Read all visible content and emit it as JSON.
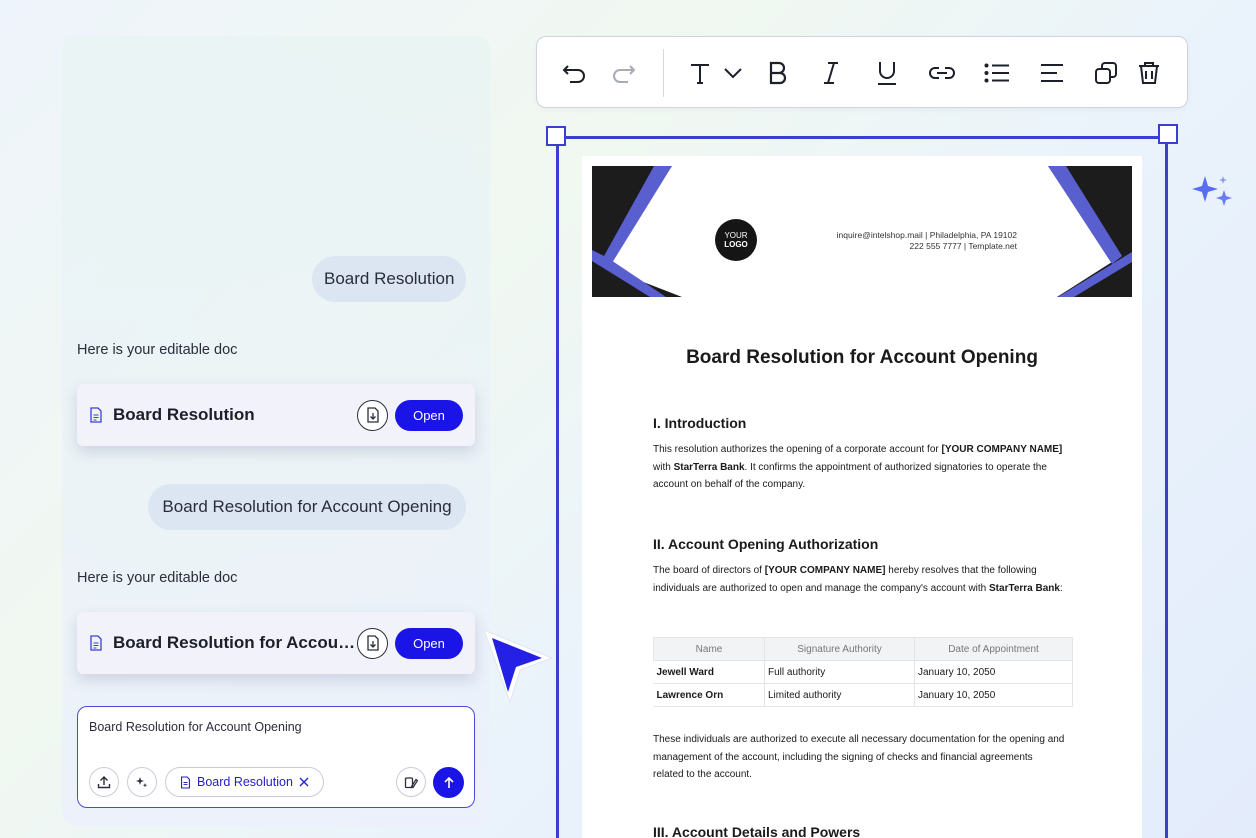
{
  "chat": {
    "messages": [
      {
        "type": "user",
        "text": "Board Resolution"
      },
      {
        "type": "assistant",
        "text": "Here is your editable doc"
      },
      {
        "type": "user",
        "text": "Board Resolution for Account Opening"
      },
      {
        "type": "assistant",
        "text": "Here is your editable doc"
      }
    ],
    "cards": [
      {
        "title": "Board Resolution",
        "open_label": "Open"
      },
      {
        "title": "Board Resolution for Account…",
        "open_label": "Open"
      }
    ],
    "input": {
      "text": "Board Resolution for Account Opening",
      "chip_label": "Board Resolution"
    }
  },
  "toolbar": {
    "icons": [
      "undo-icon",
      "redo-icon",
      "text-style-icon",
      "chevron-down-icon",
      "bold-icon",
      "italic-icon",
      "underline-icon",
      "link-icon",
      "list-icon",
      "align-icon",
      "duplicate-icon",
      "delete-icon"
    ]
  },
  "document": {
    "logo_line1": "YOUR",
    "logo_line2": "LOGO",
    "contact_line1": "inquire@intelshop.mail | Philadelphia, PA 19102",
    "contact_line2": "222 555 7777 | Template.net",
    "title": "Board Resolution for Account Opening",
    "sections": [
      {
        "heading": "I. Introduction"
      },
      {
        "heading": "II. Account Opening Authorization"
      },
      {
        "heading": "III. Account Details and Powers"
      }
    ],
    "intro_p1": "This resolution authorizes the opening of a corporate account for ",
    "intro_b1": "[YOUR COMPANY NAME]",
    "intro_p2": " with ",
    "intro_b2": "StarTerra Bank",
    "intro_p3": ". It confirms the appointment of authorized signatories to operate the account on behalf of the company.",
    "auth_p1": "The board of directors of ",
    "auth_b1": "[YOUR COMPANY NAME]",
    "auth_p2": " hereby resolves that the following individuals are authorized to open and manage the company's account with ",
    "auth_b2": "StarTerra Bank",
    "auth_p3": ":",
    "table": {
      "headers": [
        "Name",
        "Signature Authority",
        "Date of Appointment"
      ],
      "rows": [
        [
          "Jewell Ward",
          "Full authority",
          "January 10, 2050"
        ],
        [
          "Lawrence Orn",
          "Limited authority",
          "January 10, 2050"
        ]
      ]
    },
    "closing": "These individuals are authorized to execute all necessary documentation for the opening and management of the account, including the signing of checks and financial agreements related to the account."
  },
  "colors": {
    "accent": "#1a14e6",
    "frame": "#3a3fd2",
    "banner_stripe": "#5a5fd0",
    "banner_dark": "#1c1c1c"
  }
}
